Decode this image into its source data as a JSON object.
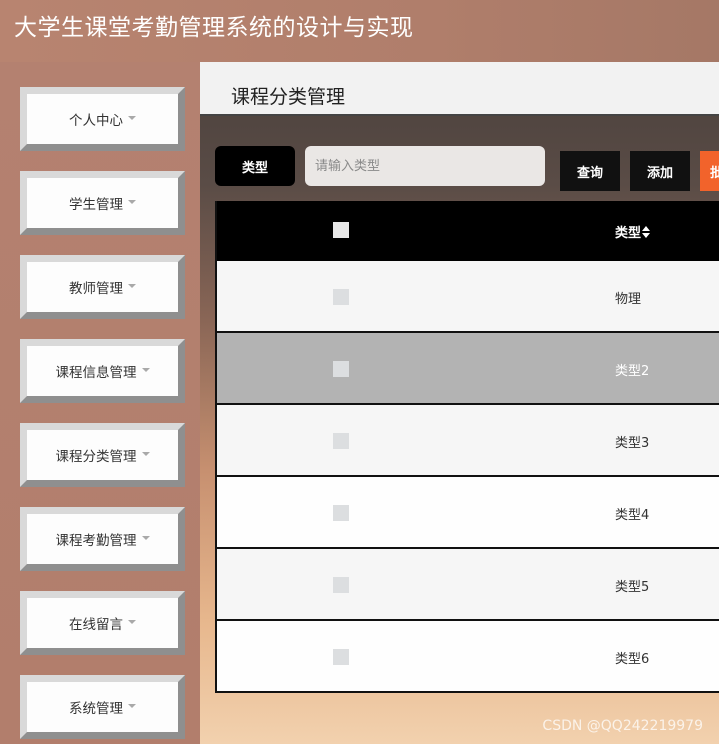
{
  "app": {
    "title": "大学生课堂考勤管理系统的设计与实现"
  },
  "sidebar": {
    "items": [
      {
        "label": "个人中心"
      },
      {
        "label": "学生管理"
      },
      {
        "label": "教师管理"
      },
      {
        "label": "课程信息管理"
      },
      {
        "label": "课程分类管理"
      },
      {
        "label": "课程考勤管理"
      },
      {
        "label": "在线留言"
      },
      {
        "label": "系统管理"
      }
    ]
  },
  "page": {
    "title": "课程分类管理"
  },
  "search": {
    "label": "类型",
    "placeholder": "请输入类型",
    "query_button": "查询",
    "add_button": "添加",
    "batch_button": "批"
  },
  "table": {
    "columns": {
      "type": "类型"
    },
    "rows": [
      {
        "type": "物理"
      },
      {
        "type": "类型2"
      },
      {
        "type": "类型3"
      },
      {
        "type": "类型4"
      },
      {
        "type": "类型5"
      },
      {
        "type": "类型6"
      }
    ]
  },
  "watermark": "CSDN @QQ242219979",
  "colors": {
    "sidebar_bg": "#b48170",
    "header_black": "#000000",
    "batch_button": "#f2632b",
    "selected_row": "#b3b3b3"
  }
}
